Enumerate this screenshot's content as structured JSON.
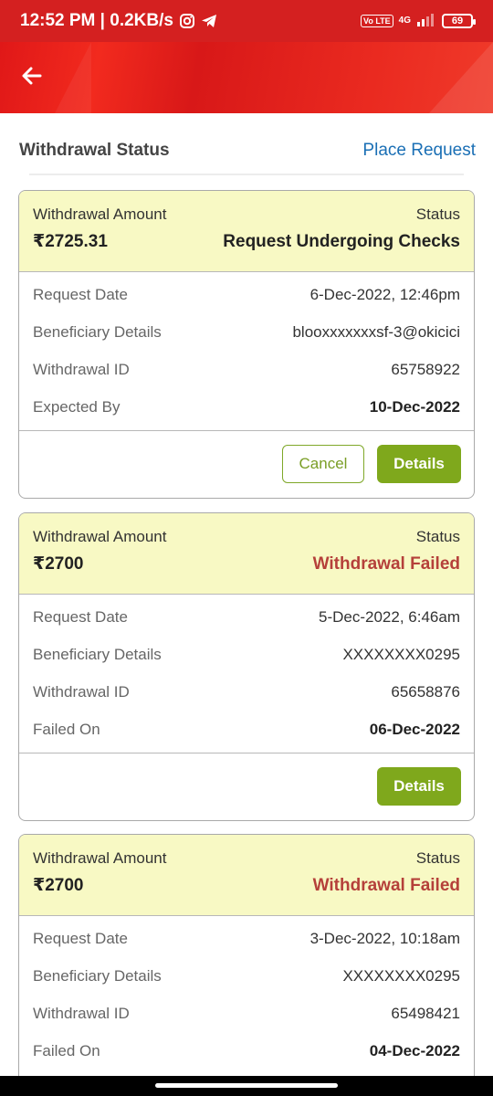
{
  "status_bar": {
    "time_net": "12:52 PM | 0.2KB/s",
    "volte": "Vo LTE",
    "network": "4G",
    "battery": "69"
  },
  "header": {
    "title": "Withdrawal Status",
    "place_request": "Place Request"
  },
  "labels": {
    "withdrawal_amount": "Withdrawal Amount",
    "status": "Status",
    "request_date": "Request Date",
    "beneficiary_details": "Beneficiary Details",
    "withdrawal_id": "Withdrawal ID",
    "expected_by": "Expected By",
    "failed_on": "Failed On",
    "cancel": "Cancel",
    "details": "Details"
  },
  "withdrawals": [
    {
      "amount": "₹2725.31",
      "status": "Request Undergoing Checks",
      "request_date": "6-Dec-2022, 12:46pm",
      "beneficiary": "blooxxxxxxxsf-3@okicici",
      "withdrawal_id": "65758922",
      "expected_by": "10-Dec-2022"
    },
    {
      "amount": "₹2700",
      "status": "Withdrawal Failed",
      "request_date": "5-Dec-2022, 6:46am",
      "beneficiary": "XXXXXXXX0295",
      "withdrawal_id": "65658876",
      "failed_on": "06-Dec-2022"
    },
    {
      "amount": "₹2700",
      "status": "Withdrawal Failed",
      "request_date": "3-Dec-2022, 10:18am",
      "beneficiary": "XXXXXXXX0295",
      "withdrawal_id": "65498421",
      "failed_on": "04-Dec-2022"
    }
  ],
  "colors": {
    "brand_red": "#d42020",
    "card_header": "#f8f9c4",
    "failed_text": "#b5403a",
    "action_green": "#7fa81c",
    "link_blue": "#1a6fb5"
  },
  "icons": [
    "back-arrow-icon",
    "instagram-icon",
    "telegram-icon",
    "signal-icon",
    "battery-icon"
  ]
}
